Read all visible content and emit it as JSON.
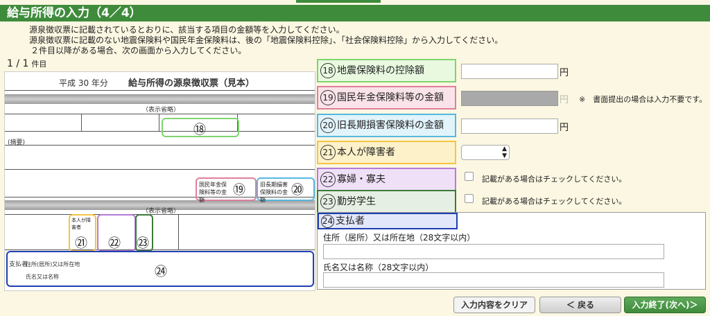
{
  "title": "給与所得の入力（4／4）",
  "instructions": [
    "源泉徴収票に記載されているとおりに、該当する項目の金額等を入力してください。",
    "源泉徴収票に記載のない地震保険料や国民年金保険料は、後の「地震保険料控除」、「社会保険料控除」から入力してください。",
    "２件目以降がある場合、次の画面から入力してください。"
  ],
  "count": {
    "value": "1 / 1",
    "unit": "件目"
  },
  "form_image": {
    "heading_year": "平成 30 年分",
    "heading_title": "給与所得の源泉徴収票（見本）",
    "omitted": "（表示省略）",
    "tekiyo": "(摘要)",
    "shiharaisha": "支払者",
    "address": "住所(居所)又は所在地",
    "name": "氏名又は名称",
    "lbl_kokumin": "国民年金保険料等の金額",
    "lbl_kyuchoki": "旧長期損害保険料の金額",
    "lbl_shogai": "本人が障害者",
    "n18": "⑱",
    "n19": "⑲",
    "n20": "⑳",
    "n21": "㉑",
    "n22": "㉒",
    "n23": "㉓",
    "n24": "㉔"
  },
  "fields": [
    {
      "num": "18",
      "label": "地震保険料の控除額",
      "yen": "円"
    },
    {
      "num": "19",
      "label": "国民年金保険料等の金額",
      "yen": "円",
      "note": "※　書面提出の場合は入力不要です。"
    },
    {
      "num": "20",
      "label": "旧長期損害保険料の金額",
      "yen": "円"
    },
    {
      "num": "21",
      "label": "本人が障害者"
    },
    {
      "num": "22",
      "label": "寡婦・寡夫",
      "check": "記載がある場合はチェックしてください。"
    },
    {
      "num": "23",
      "label": "勤労学生",
      "check": "記載がある場合はチェックしてください。"
    },
    {
      "num": "24",
      "label": "支払者"
    }
  ],
  "payer": {
    "address_label": "住所（居所）又は所在地（28文字以内）",
    "name_label": "氏名又は名称（28文字以内）"
  },
  "buttons": {
    "clear": "入力内容をクリア",
    "back": "＜ 戻る",
    "next": "入力終了(次へ)＞"
  },
  "colors": {
    "green": "#3f8b3c",
    "c18": "#7fd46f",
    "c19": "#e07f9a",
    "c20": "#57b7e0",
    "c21": "#f5c542",
    "c22": "#b57bd6",
    "c23": "#3a7a3a",
    "c24": "#1f3fb0"
  }
}
